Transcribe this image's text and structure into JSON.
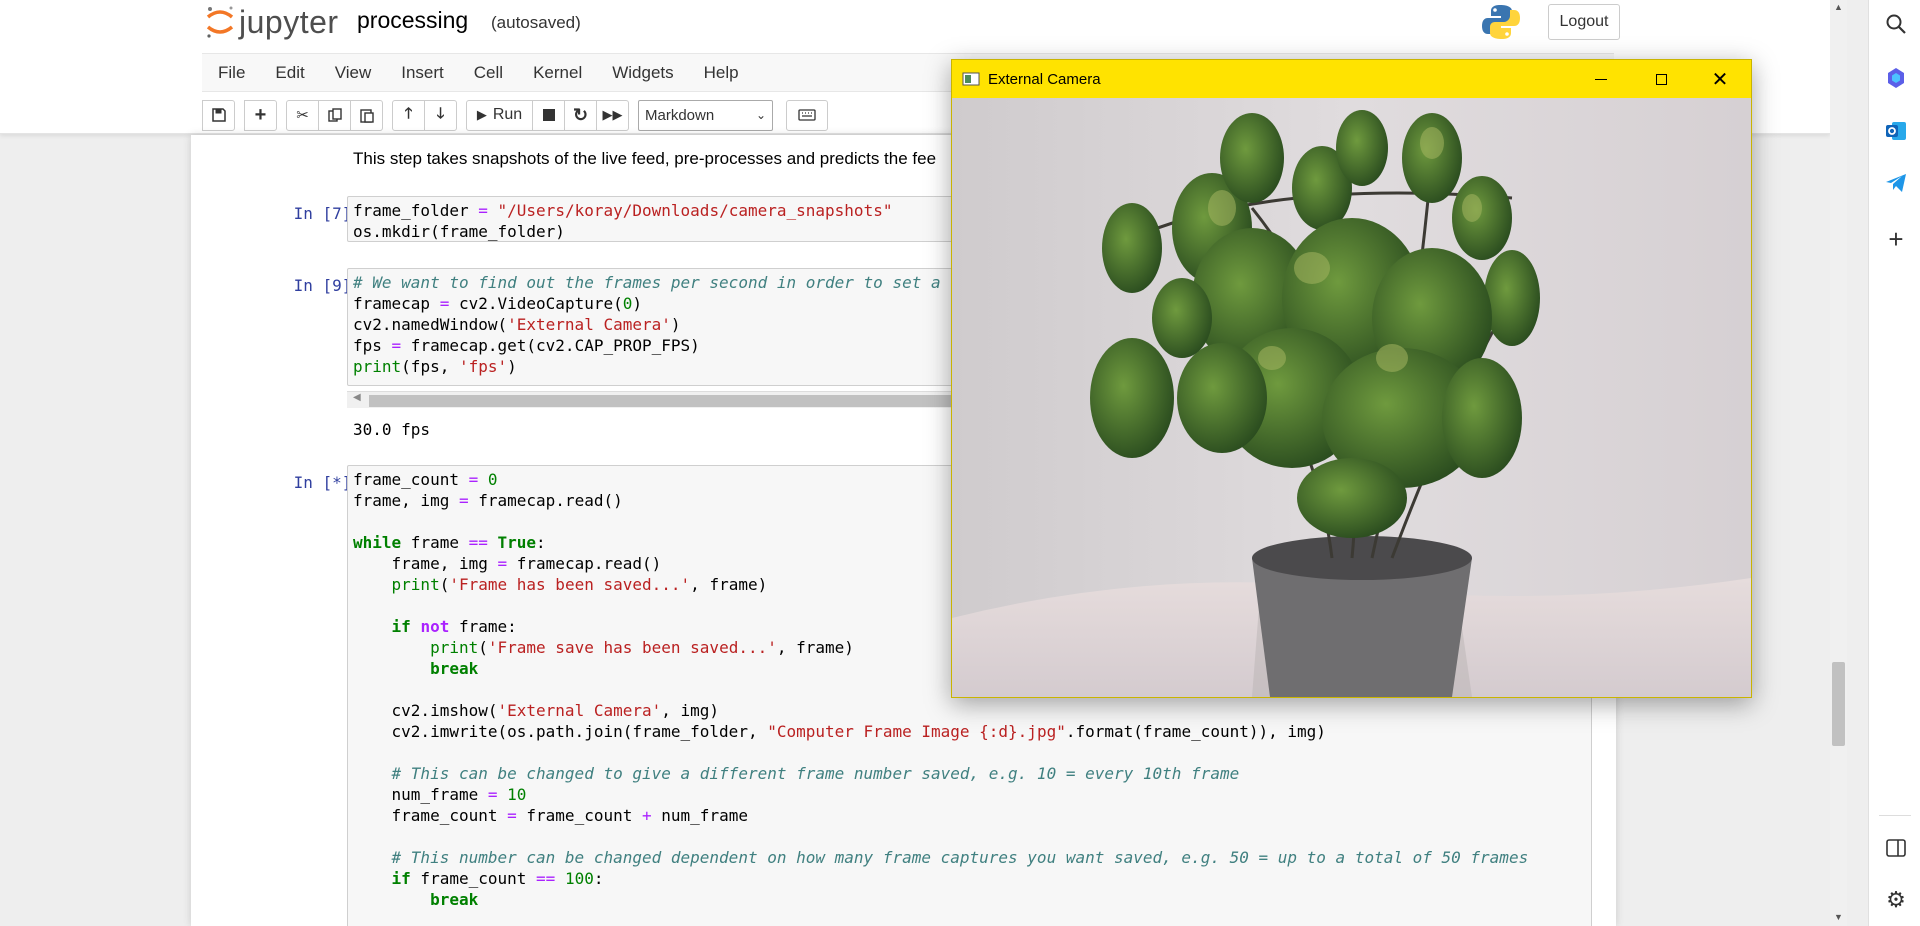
{
  "header": {
    "app_name": "jupyter",
    "notebook_name": "processing",
    "autosave_status": "(autosaved)",
    "logout_label": "Logout"
  },
  "menu": [
    "File",
    "Edit",
    "View",
    "Insert",
    "Cell",
    "Kernel",
    "Widgets",
    "Help"
  ],
  "toolbar": {
    "run_label": "Run",
    "cell_type": "Markdown",
    "icons": [
      "save-icon",
      "plus-icon",
      "scissors-icon",
      "copy-icon",
      "paste-icon",
      "arrow-up-icon",
      "arrow-down-icon",
      "play-icon",
      "stop-icon",
      "restart-icon",
      "fast-forward-icon",
      "keyboard-icon"
    ]
  },
  "notebook": {
    "markdown_text": "This step takes snapshots of the live feed, pre-processes and predicts the fee",
    "cell1": {
      "prompt": "In [7]:",
      "code": "frame_folder = \"/Users/koray/Downloads/camera_snapshots\"\nos.mkdir(frame_folder)"
    },
    "cell2": {
      "prompt": "In [9]:",
      "code": "# We want to find out the frames per second in order to set a\nframecap = cv2.VideoCapture(0)\ncv2.namedWindow('External Camera')\nfps = framecap.get(cv2.CAP_PROP_FPS)\nprint(fps, 'fps')",
      "output": "30.0 fps"
    },
    "cell3": {
      "prompt": "In [*]:",
      "code": "frame_count = 0\nframe, img = framecap.read()\n\nwhile frame == True:\n    frame, img = framecap.read()\n    print('Frame has been saved...', frame)\n\n    if not frame:\n        print('Frame save has been saved...', frame)\n        break\n\n    cv2.imshow('External Camera', img)\n    cv2.imwrite(os.path.join(frame_folder, \"Computer Frame Image {:d}.jpg\".format(frame_count)), img)\n\n    # This can be changed to give a different frame number saved, e.g. 10 = every 10th frame\n    num_frame = 10\n    frame_count = frame_count + num_frame\n\n    # This number can be changed dependent on how many frame captures you want saved, e.g. 50 = up to a total of 50 frames\n    if frame_count == 100:\n        break"
    }
  },
  "camera_window": {
    "title": "External Camera"
  },
  "sidebar": {
    "icons": [
      "search-icon",
      "copilot-icon",
      "outlook-icon",
      "telegram-icon",
      "add-icon",
      "split-view-icon",
      "settings-icon"
    ]
  },
  "colors": {
    "header_bg": "#ffffff",
    "page_bg": "#eeeeee",
    "camera_titlebar": "#ffe300",
    "prompt": "#303f9f",
    "keyword": "#008000",
    "string": "#ba2121",
    "operator": "#aa22ff",
    "comment": "#408080"
  }
}
